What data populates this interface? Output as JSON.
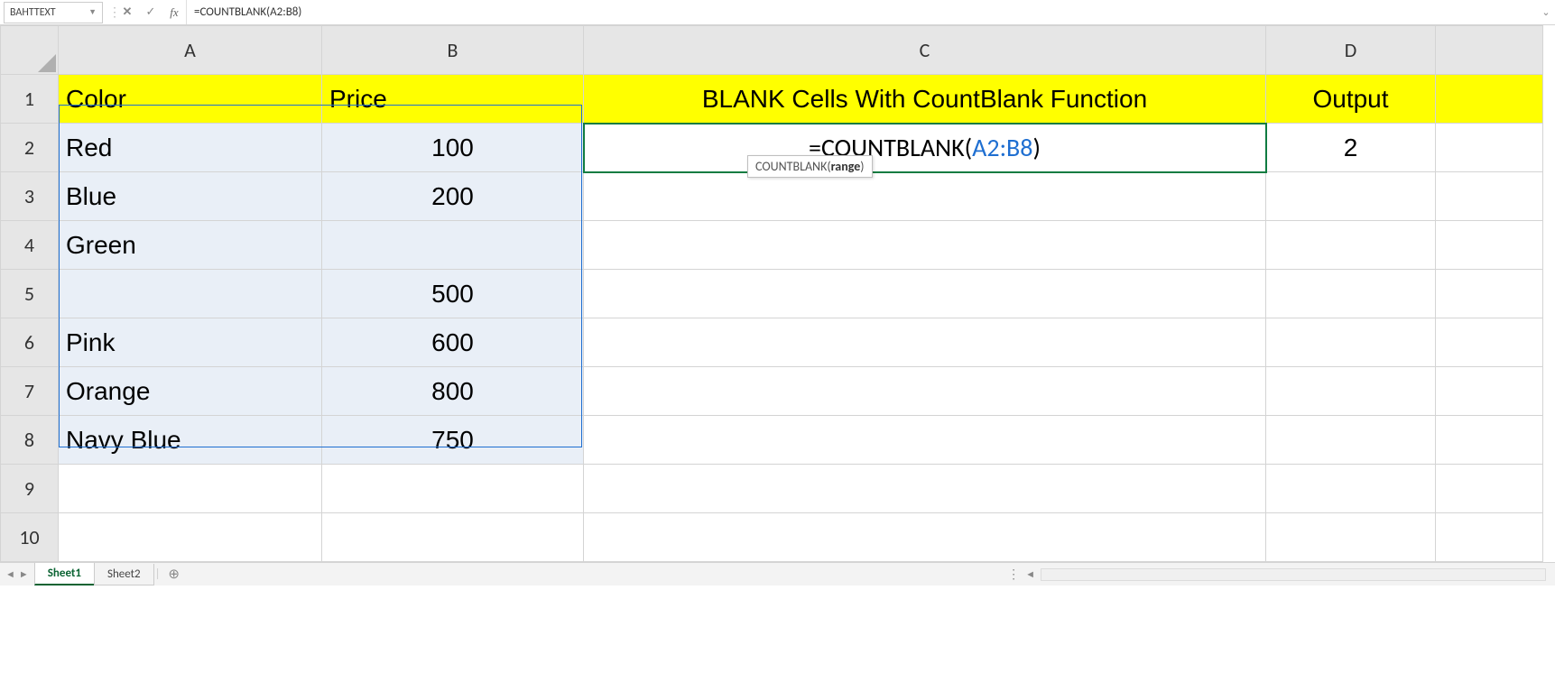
{
  "formula_bar": {
    "name_box": "BAHTTEXT",
    "cancel_glyph": "✕",
    "enter_glyph": "✓",
    "fx_label": "fx",
    "formula_text": "=COUNTBLANK(A2:B8)",
    "expand_glyph": "⌄"
  },
  "columns": {
    "A": "A",
    "B": "B",
    "C": "C",
    "D": "D",
    "E": ""
  },
  "rows": [
    "1",
    "2",
    "3",
    "4",
    "5",
    "6",
    "7",
    "8",
    "9",
    "10"
  ],
  "headers": {
    "A": "Color",
    "B": "Price",
    "C": "BLANK Cells With CountBlank Function",
    "D": "Output"
  },
  "data": {
    "A2": "Red",
    "B2": "100",
    "A3": "Blue",
    "B3": "200",
    "A4": "Green",
    "B4": "",
    "A5": "",
    "B5": "500",
    "A6": "Pink",
    "B6": "600",
    "A7": "Orange",
    "B7": "800",
    "A8": "Navy Blue",
    "B8": "750"
  },
  "editing_cell": {
    "prefix": "=COUNTBLANK(",
    "ref": "A2:B8",
    "suffix": ")"
  },
  "output_value": "2",
  "tooltip": {
    "fn": "COUNTBLANK(",
    "arg": "range",
    "close": ")"
  },
  "sheet_tabs": {
    "prev_glyph": "◄",
    "next_glyph": "►",
    "tabs": [
      {
        "label": "Sheet1",
        "active": true
      },
      {
        "label": "Sheet2",
        "active": false
      }
    ],
    "add_glyph": "⊕",
    "sep_glyph": "⋮",
    "scroll_left_glyph": "◄"
  }
}
